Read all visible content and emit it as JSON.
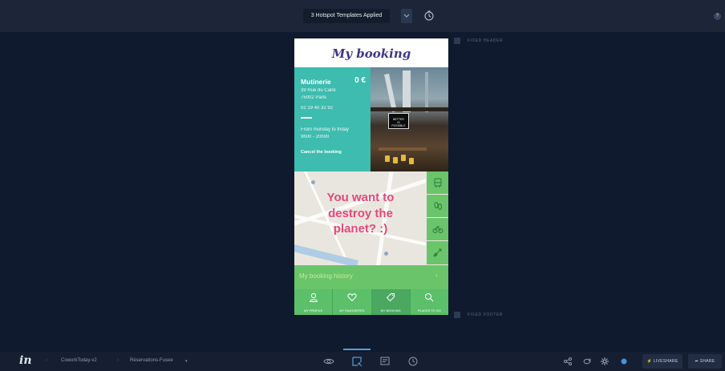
{
  "topbar": {
    "templates_label": "3 Hotspot Templates Applied",
    "caret_icon": "chevron-down-icon",
    "timer_icon": "clock-icon",
    "help_label": "?"
  },
  "screen": {
    "title": "My booking",
    "venue": {
      "name": "Mutinerie",
      "price": "0 €",
      "address_line1": "39 Rue du Caire",
      "address_line2": "75002 Paris",
      "phone": "02 19 40 32 92",
      "hours_line1": "From monday to friday",
      "hours_line2": "9h00 - 20h00",
      "cancel_label": "Cancel the booking"
    },
    "photo_sign_line1": "BETTER",
    "photo_sign_line2": "IS",
    "photo_sign_line3": "POSSIBLE",
    "map_message_line1": "You want to",
    "map_message_line2": "destroy the",
    "map_message_line3": "planet? :)",
    "transport_icons": [
      "bus-icon",
      "walk-icon",
      "bike-icon",
      "rocket-icon"
    ],
    "history_label": "My booking history",
    "history_arrow": "›",
    "tabs": [
      {
        "label": "MY PROFILE",
        "icon": "user-icon"
      },
      {
        "label": "MY FAVOURITES",
        "icon": "heart-icon"
      },
      {
        "label": "MY BOOKING",
        "icon": "tag-icon"
      },
      {
        "label": "PLACES TO GO",
        "icon": "search-icon"
      }
    ]
  },
  "side_labels": {
    "fixed_header": "FIXED HEADER",
    "fixed_footer": "FIXED FOOTER"
  },
  "bottombar": {
    "logo": "in",
    "crumb_sep": "›",
    "project": "CoworkToday-v2",
    "screen": "Réservations-Fusee",
    "screen_caret": "▾",
    "modes": [
      "preview-icon",
      "build-icon",
      "comment-icon",
      "history-icon"
    ],
    "right_icons": [
      "share-nodes-icon",
      "sync-icon",
      "settings-icon",
      "status-dot-icon"
    ],
    "liveshare_label": "⚡ LIVESHARE",
    "share_label": "➦ SHARE"
  },
  "colors": {
    "background": "#0f1a2e",
    "teal": "#3dbcaf",
    "green": "#6ac46a",
    "title_purple": "#3c3787",
    "message_pink": "#e8467a",
    "accent_blue": "#5b9bd5"
  }
}
